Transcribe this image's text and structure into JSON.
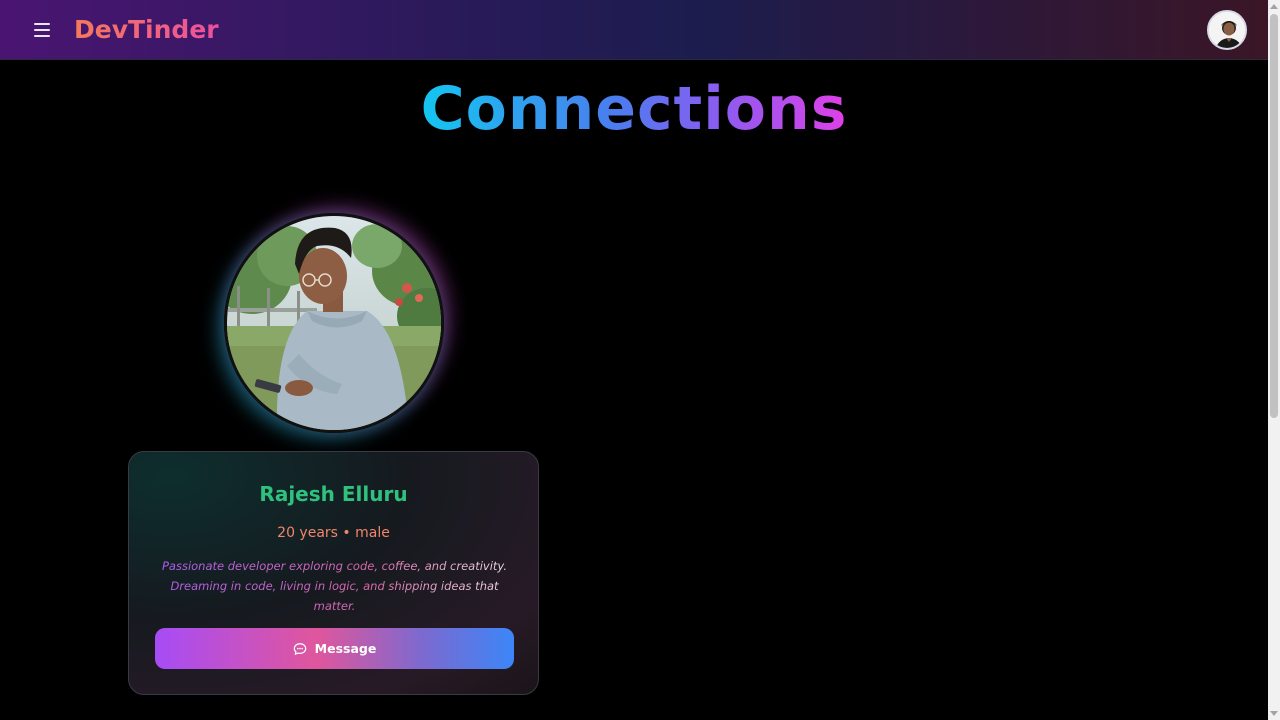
{
  "navbar": {
    "brand": "DevTinder",
    "menu_icon": "hamburger-menu-icon",
    "avatar_icon": "user-avatar"
  },
  "page": {
    "title": "Connections"
  },
  "connections": [
    {
      "name": "Rajesh Elluru",
      "meta": "20 years • male",
      "bio": "Passionate developer exploring code, coffee, and creativity. Dreaming in code, living in logic, and shipping ideas that matter.",
      "button_label": "Message",
      "button_icon": "chat-bubble-icon"
    }
  ],
  "colors": {
    "name": "#2ec27e",
    "meta": "#f0856a",
    "background": "#000000"
  }
}
